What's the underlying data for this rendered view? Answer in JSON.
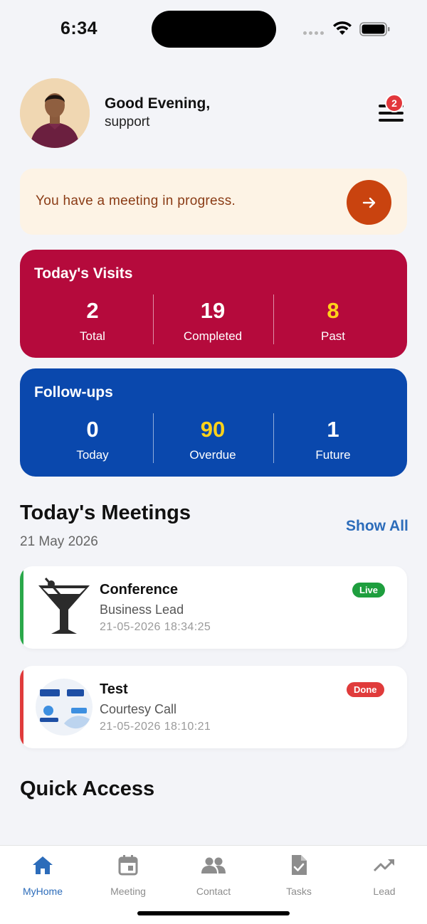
{
  "status_bar": {
    "time": "6:34"
  },
  "header": {
    "greeting": "Good Evening,",
    "username": "support",
    "notification_count": "2"
  },
  "banner": {
    "text": "You have a meeting in progress."
  },
  "visits": {
    "title": "Today's Visits",
    "stats": [
      {
        "value": "2",
        "label": "Total",
        "color": "#ffffff"
      },
      {
        "value": "19",
        "label": "Completed",
        "color": "#ffffff"
      },
      {
        "value": "8",
        "label": "Past",
        "color": "#ffd21a"
      }
    ]
  },
  "followups": {
    "title": "Follow-ups",
    "stats": [
      {
        "value": "0",
        "label": "Today",
        "color": "#ffffff"
      },
      {
        "value": "90",
        "label": "Overdue",
        "color": "#ffd21a"
      },
      {
        "value": "1",
        "label": "Future",
        "color": "#ffffff"
      }
    ]
  },
  "meetings_section": {
    "title": "Today's Meetings",
    "date": "21 May 2026",
    "show_all": "Show All",
    "items": [
      {
        "title": "Conference",
        "type": "Business Lead",
        "datetime": "21-05-2026 18:34:25",
        "status": "Live",
        "status_color": "#1e9e3e",
        "accent": "#2aa84a",
        "icon": "cocktail-glass-icon"
      },
      {
        "title": "Test",
        "type": "Courtesy Call",
        "datetime": "21-05-2026 18:10:21",
        "status": "Done",
        "status_color": "#e03b3b",
        "accent": "#e03b3b",
        "icon": "company-logo"
      }
    ]
  },
  "quick_access": {
    "title": "Quick Access"
  },
  "tab_bar": {
    "items": [
      {
        "label": "MyHome",
        "icon": "home-icon",
        "active": true
      },
      {
        "label": "Meeting",
        "icon": "calendar-icon",
        "active": false
      },
      {
        "label": "Contact",
        "icon": "people-icon",
        "active": false
      },
      {
        "label": "Tasks",
        "icon": "task-document-icon",
        "active": false
      },
      {
        "label": "Lead",
        "icon": "trend-up-icon",
        "active": false
      }
    ]
  },
  "colors": {
    "visits_card": "#b50a3c",
    "followups_card": "#0a48ad",
    "accent_blue": "#2c6cba",
    "banner_bg": "#fdf3e5",
    "banner_button": "#c9430f"
  }
}
